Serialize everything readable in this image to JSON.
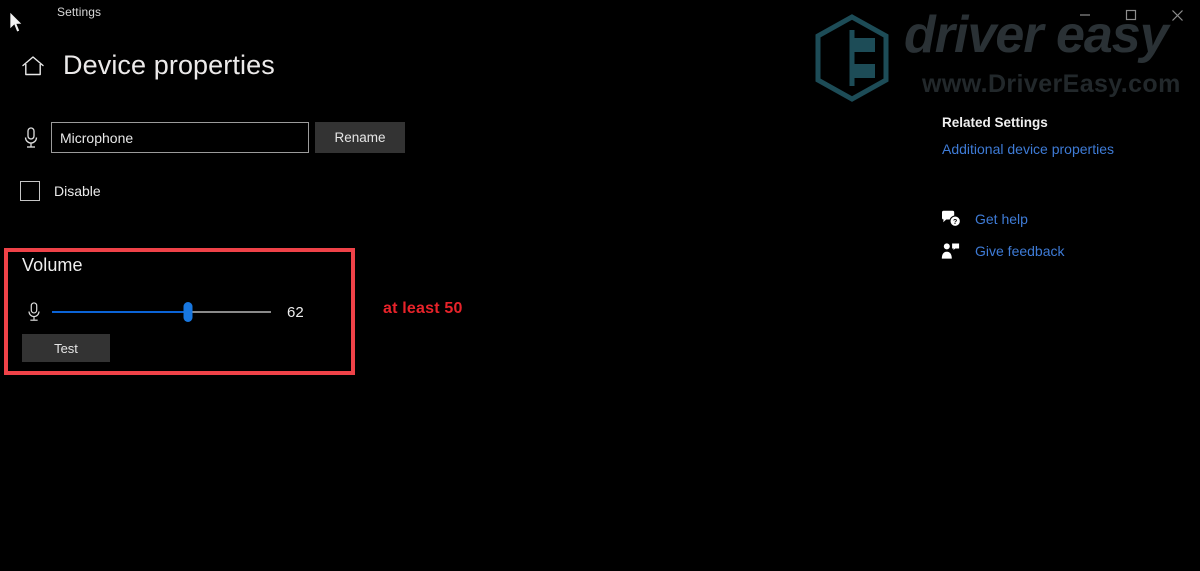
{
  "window": {
    "title": "Settings",
    "controls": [
      {
        "name": "minimize",
        "glyph": "minimize-icon"
      },
      {
        "name": "maximize",
        "glyph": "maximize-icon"
      },
      {
        "name": "close",
        "glyph": "close-icon"
      }
    ]
  },
  "watermark": {
    "brand": "driver easy",
    "url": "www.DriverEasy.com",
    "logo_icon": "hexagon-logo-icon",
    "brand_color": "#2a3135"
  },
  "header": {
    "home_icon": "home-icon",
    "title": "Device properties"
  },
  "device": {
    "mic_icon": "microphone-icon",
    "name_value": "Microphone",
    "name_placeholder": "Microphone",
    "rename_label": "Rename",
    "disable_label": "Disable",
    "disable_checked": false
  },
  "volume": {
    "heading": "Volume",
    "mic_icon": "microphone-icon",
    "value": "62",
    "value_number": 62,
    "min": 0,
    "max": 100,
    "test_label": "Test",
    "fill_color": "#0b63d6",
    "thumb_color": "#1877e0"
  },
  "annotation": {
    "text": "at least 50",
    "color": "#e8232a",
    "box_color": "#ef4248"
  },
  "related": {
    "title": "Related Settings",
    "links": [
      {
        "label": "Additional device properties"
      }
    ],
    "support": [
      {
        "label": "Get help",
        "icon": "help-chat-icon"
      },
      {
        "label": "Give feedback",
        "icon": "feedback-person-icon"
      }
    ],
    "link_color": "#3e7bd6"
  }
}
